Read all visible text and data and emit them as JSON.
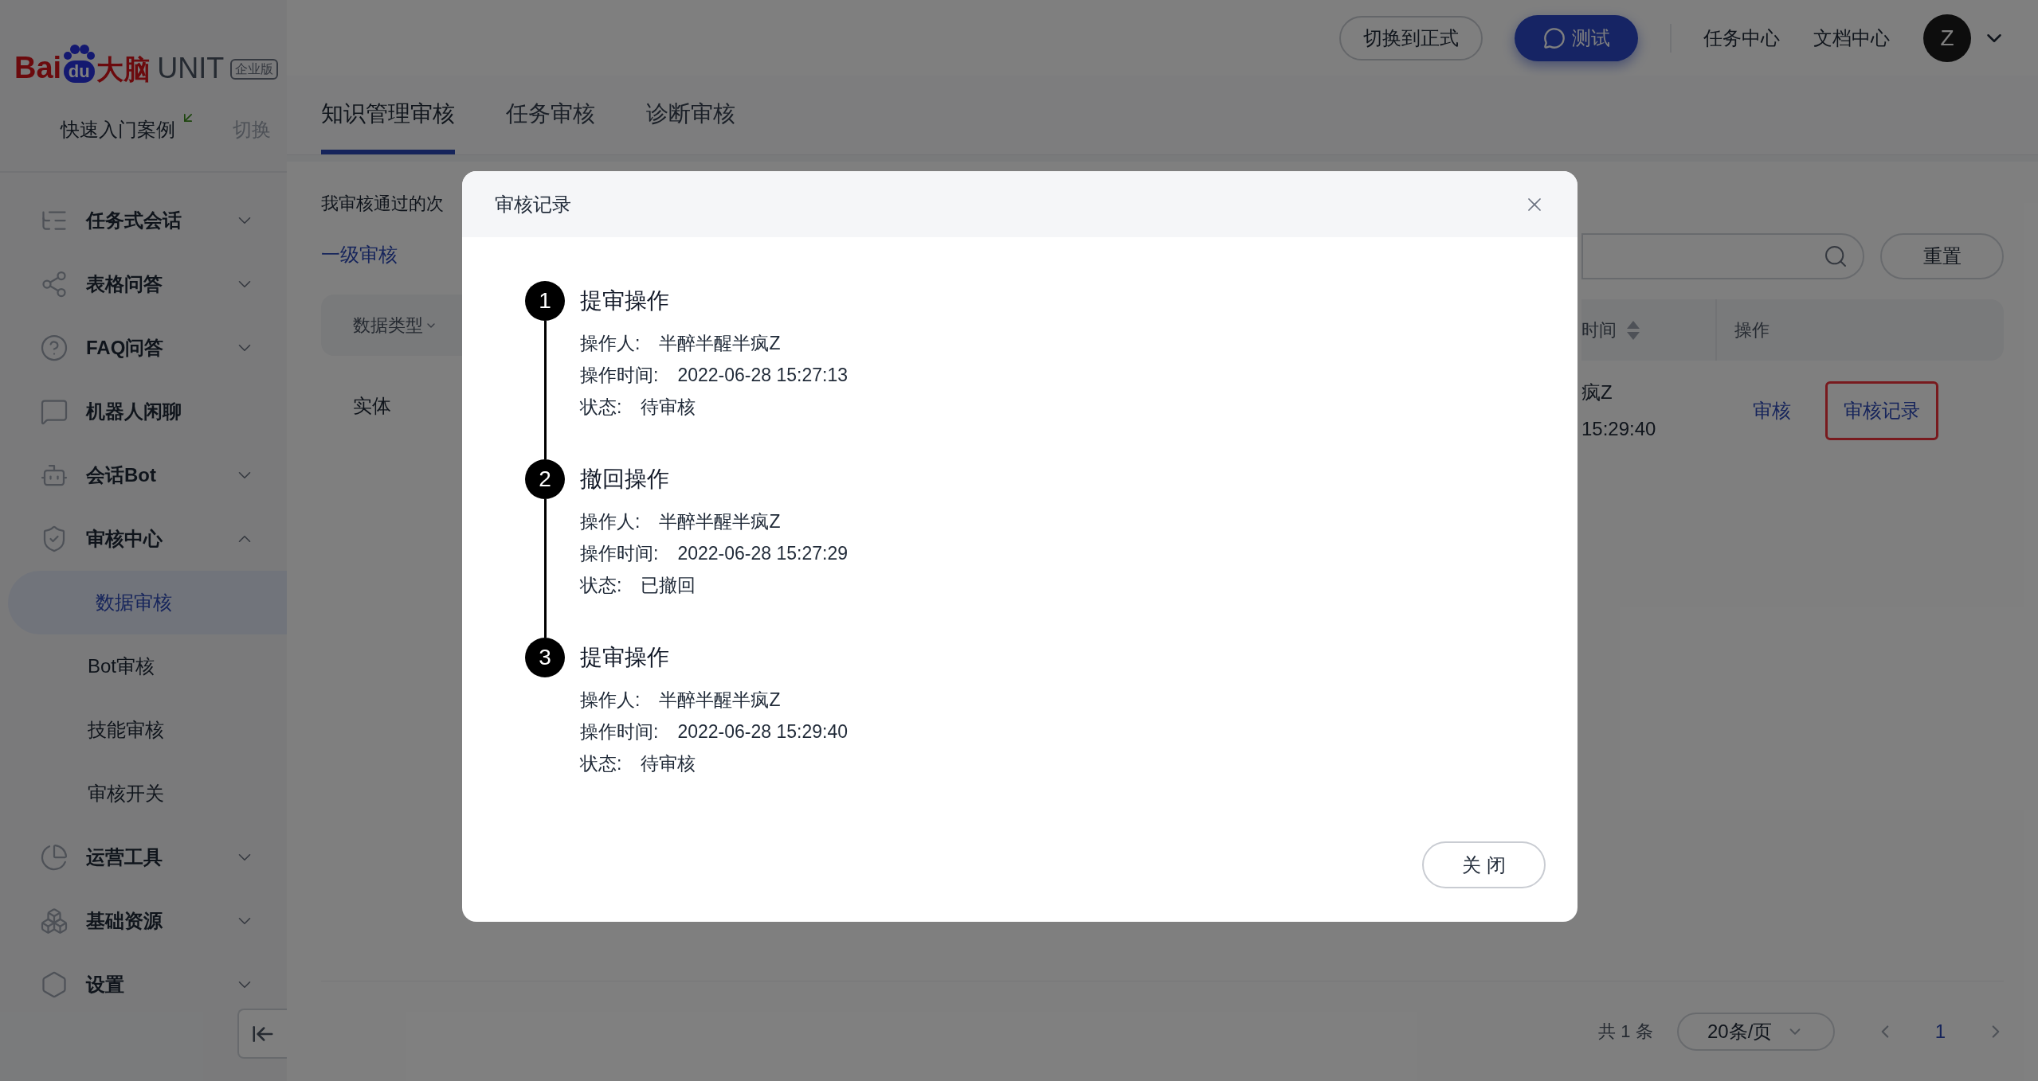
{
  "sidebar": {
    "logo": {
      "brand": "Bai",
      "paw_text": "du",
      "brand_cn": "大脑",
      "product": "UNIT",
      "edition": "企业版"
    },
    "quick_start": "快速入门案例",
    "switch_link": "切换",
    "items": [
      {
        "label": "任务式会话",
        "kind": "group",
        "expanded": false
      },
      {
        "label": "表格问答",
        "kind": "group",
        "expanded": false
      },
      {
        "label": "FAQ问答",
        "kind": "group",
        "expanded": false
      },
      {
        "label": "机器人闲聊",
        "kind": "link"
      },
      {
        "label": "会话Bot",
        "kind": "group",
        "expanded": false
      },
      {
        "label": "审核中心",
        "kind": "group",
        "expanded": true,
        "children": [
          {
            "label": "数据审核",
            "selected": true
          },
          {
            "label": "Bot审核",
            "selected": false
          },
          {
            "label": "技能审核",
            "selected": false
          },
          {
            "label": "审核开关",
            "selected": false
          }
        ]
      },
      {
        "label": "运营工具",
        "kind": "group",
        "expanded": false
      },
      {
        "label": "基础资源",
        "kind": "group",
        "expanded": false
      },
      {
        "label": "设置",
        "kind": "group",
        "expanded": false
      }
    ]
  },
  "header": {
    "switch_button": "切换到正式",
    "test_button": "测试",
    "links": [
      "任务中心",
      "文档中心"
    ],
    "avatar": "Z"
  },
  "tabs": [
    {
      "label": "知识管理审核",
      "selected": true
    },
    {
      "label": "任务审核",
      "selected": false
    },
    {
      "label": "诊断审核",
      "selected": false
    }
  ],
  "stats_text": "我审核通过的次",
  "level_tabs": [
    {
      "label": "一级审核",
      "selected": true
    }
  ],
  "reset_button": "重置",
  "table": {
    "columns": [
      {
        "label": "数据类型",
        "kind": "filter"
      },
      {
        "label": "时间",
        "kind": "sort"
      },
      {
        "label": "操作",
        "kind": "plain"
      }
    ],
    "row": {
      "type": "实体",
      "operator": "疯Z",
      "time": "15:29:40",
      "actions": [
        {
          "label": "审核",
          "highlighted": false
        },
        {
          "label": "审核记录",
          "highlighted": true
        }
      ]
    }
  },
  "pagination": {
    "total": "共 1 条",
    "page_size": "20条/页",
    "pages": [
      {
        "label": "1",
        "selected": true
      }
    ]
  },
  "dialog": {
    "title": "审核记录",
    "close_button": "关 闭",
    "steps": [
      {
        "number": "1",
        "title": "提审操作",
        "fields": [
          {
            "label": "操作人:",
            "value": "半醉半醒半疯Z"
          },
          {
            "label": "操作时间:",
            "value": "2022-06-28 15:27:13"
          },
          {
            "label": "状态:",
            "value": "待审核"
          }
        ]
      },
      {
        "number": "2",
        "title": "撤回操作",
        "fields": [
          {
            "label": "操作人:",
            "value": "半醉半醒半疯Z"
          },
          {
            "label": "操作时间:",
            "value": "2022-06-28 15:27:29"
          },
          {
            "label": "状态:",
            "value": "已撤回"
          }
        ]
      },
      {
        "number": "3",
        "title": "提审操作",
        "fields": [
          {
            "label": "操作人:",
            "value": "半醉半醒半疯Z"
          },
          {
            "label": "操作时间:",
            "value": "2022-06-28 15:29:40"
          },
          {
            "label": "状态:",
            "value": "待审核"
          }
        ]
      }
    ]
  }
}
